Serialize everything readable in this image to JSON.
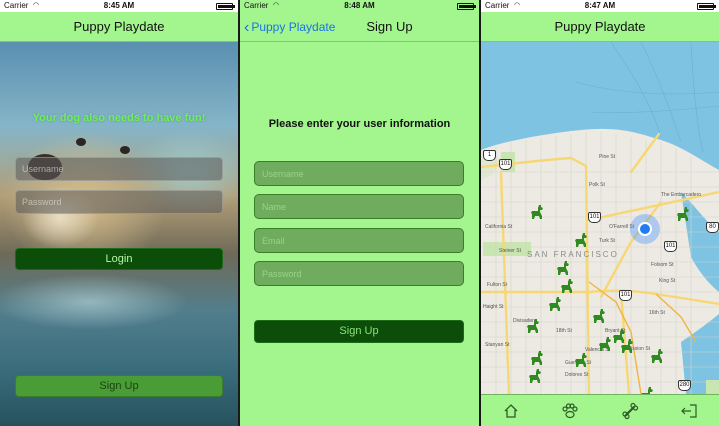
{
  "screens": {
    "login": {
      "status": {
        "carrier": "Carrier",
        "time": "8:45 AM"
      },
      "nav_title": "Puppy Playdate",
      "tagline": "Your dog also needs to have fun!",
      "username_placeholder": "Username",
      "password_placeholder": "Password",
      "login_label": "Login",
      "signup_label": "Sign Up"
    },
    "signup": {
      "status": {
        "carrier": "Carrier",
        "time": "8:48 AM"
      },
      "back_label": "Puppy Playdate",
      "nav_title": "Sign Up",
      "heading": "Please enter your user information",
      "fields": {
        "username_placeholder": "Username",
        "name_placeholder": "Name",
        "email_placeholder": "Email",
        "password_placeholder": "Password"
      },
      "signup_label": "Sign Up"
    },
    "map": {
      "status": {
        "carrier": "Carrier",
        "time": "8:47 AM"
      },
      "nav_title": "Puppy Playdate",
      "city_label": "SAN FRANCISCO",
      "highway_labels": [
        "101",
        "1",
        "101",
        "101",
        "101",
        "80",
        "280"
      ],
      "street_labels": [
        "Pine St",
        "California St",
        "Turk St",
        "Fulton St",
        "Haight St",
        "Folsom St",
        "16th St",
        "18th St",
        "Valencia St",
        "Guerrero St",
        "Dolores St",
        "Bryant St",
        "Mission St",
        "King St",
        "The Embarcadero",
        "Steiner St",
        "Divisadero",
        "Stanyan St",
        "Polk St",
        "O'Farrell St"
      ],
      "dog_markers_count": 16,
      "tabs": [
        "home-icon",
        "paw-icon",
        "bone-icon",
        "logout-icon"
      ]
    }
  },
  "colors": {
    "nav_green": "#a3f58e",
    "dark_green": "#0b4d09",
    "mid_green": "#4a9c36",
    "field_green": "#6fac5d",
    "accent_blue": "#1a73e8",
    "tagline_green": "#6ef05a"
  },
  "battery_level": 1.0
}
